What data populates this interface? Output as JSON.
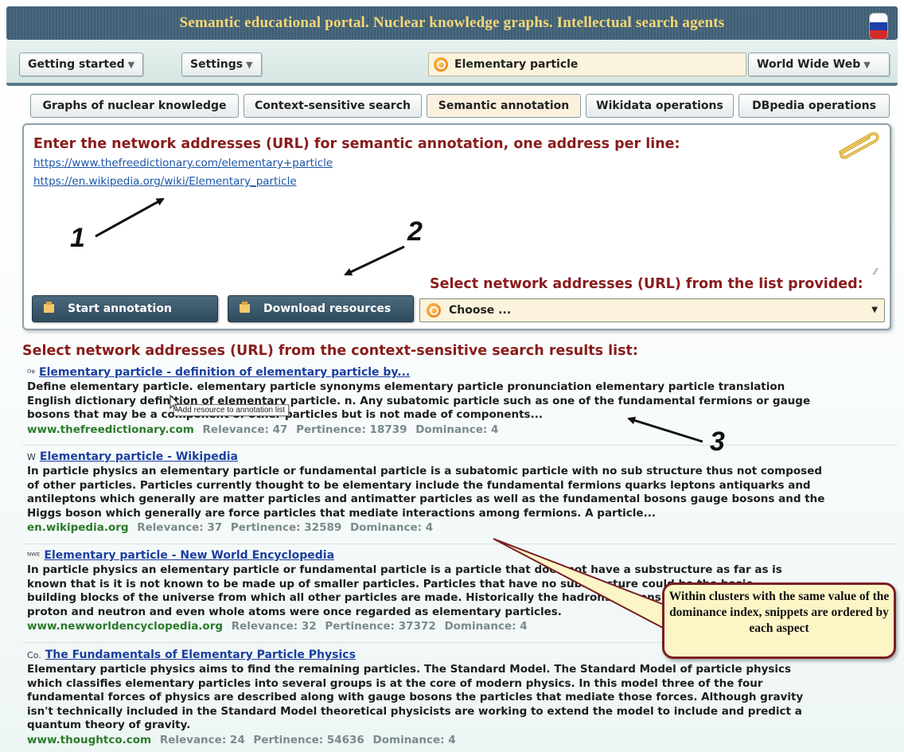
{
  "header": {
    "title": "Semantic educational portal. Nuclear knowledge graphs. Intellectual search agents"
  },
  "navbar": {
    "getting_started": "Getting started",
    "settings": "Settings",
    "search_value": "Elementary particle",
    "scope": "World Wide Web"
  },
  "tabs": [
    {
      "label": "Graphs of nuclear knowledge"
    },
    {
      "label": "Context-sensitive search"
    },
    {
      "label": "Semantic annotation",
      "active": true
    },
    {
      "label": "Wikidata operations"
    },
    {
      "label": "DBpedia operations"
    }
  ],
  "annotation": {
    "heading": "Enter the network addresses (URL) for semantic annotation, one address per line:",
    "urls": [
      "https://www.thefreedictionary.com/elementary+particle",
      "https://en.wikipedia.org/wiki/Elementary_particle"
    ],
    "start_button": "Start annotation",
    "download_button": "Download resources",
    "select_label": "Select network addresses (URL) from the list provided:",
    "choose_value": "Choose ..."
  },
  "results": {
    "heading": "Select network addresses (URL) from the context-sensitive search results list:",
    "tooltip": "Add resource to annotation list",
    "items": [
      {
        "favicon": "ᴼᵠ",
        "title": "Elementary particle - definition of elementary particle by...",
        "lines": [
          "Define elementary particle. elementary particle synonyms elementary particle pronunciation elementary particle translation",
          "English dictionary definition of elementary particle. n. Any subatomic particle such as one of the fundamental fermions or gauge",
          "bosons that may be a component of other particles but is not made of components..."
        ],
        "domain": "www.thefreedictionary.com",
        "relevance": "Relevance: 47",
        "pertinence": "Pertinence: 18739",
        "dominance": "Dominance: 4"
      },
      {
        "favicon": "W",
        "title": "Elementary particle - Wikipedia",
        "lines": [
          "In particle physics an elementary particle or fundamental particle is a subatomic particle with no sub structure thus not composed",
          "of other particles. Particles currently thought to be elementary include the fundamental fermions quarks leptons antiquarks and",
          "antileptons which generally are matter particles and antimatter particles as well as the fundamental bosons gauge bosons and the",
          "Higgs boson which generally are force particles that mediate interactions among fermions. A particle..."
        ],
        "domain": "en.wikipedia.org",
        "relevance": "Relevance: 37",
        "pertinence": "Pertinence: 32589",
        "dominance": "Dominance: 4"
      },
      {
        "favicon": "ᴺᵂᴱ",
        "title": "Elementary particle - New World Encyclopedia",
        "lines": [
          "In particle physics an elementary particle or fundamental particle is a particle that does not have a substructure as far as is",
          "known that is it is not known to be made up of smaller particles. Particles that have no substructure could be the basic",
          "building blocks of the universe from which all other particles are made. Historically the hadrons mesons and baryons such as the",
          "proton and neutron and even whole atoms were once regarded as elementary particles."
        ],
        "domain": "www.newworldencyclopedia.org",
        "relevance": "Relevance: 32",
        "pertinence": "Pertinence: 37372",
        "dominance": "Dominance: 4"
      },
      {
        "favicon": "Co.",
        "title": "The Fundamentals of Elementary Particle Physics",
        "lines": [
          "Elementary particle physics aims to find the remaining particles. The Standard Model. The Standard Model of particle physics",
          "which classifies elementary particles into several groups is at the core of modern physics. In this model three of the four",
          "fundamental forces of physics are described along with gauge bosons the particles that mediate those forces. Although gravity",
          "isn't technically included in the Standard Model theoretical physicists are working to extend the model to include and predict a",
          "quantum theory of gravity."
        ],
        "domain": "www.thoughtco.com",
        "relevance": "Relevance: 24",
        "pertinence": "Pertinence: 54636",
        "dominance": "Dominance: 4"
      }
    ]
  },
  "callouts": {
    "one": "1",
    "two": "2",
    "three": "3",
    "note": "Within clusters with the same value of the dominance index, snippets are ordered by each aspect"
  },
  "colors": {
    "header_text": "#f7d776",
    "heading_red": "#8a1c1c",
    "link_blue": "#1a3fa0",
    "domain_green": "#2a7a2a",
    "note_border": "#7a1e24"
  }
}
